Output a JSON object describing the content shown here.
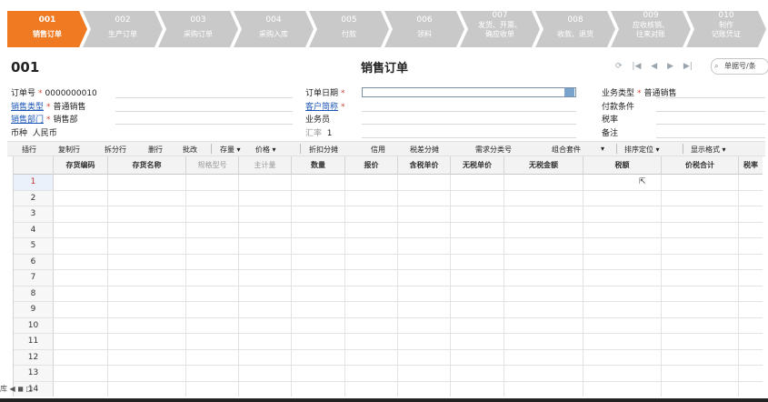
{
  "steps": [
    {
      "num": "001",
      "label": "销售订单",
      "active": true
    },
    {
      "num": "002",
      "label": "生产订单"
    },
    {
      "num": "003",
      "label": "采购订单"
    },
    {
      "num": "004",
      "label": "采购入库"
    },
    {
      "num": "005",
      "label": "付款"
    },
    {
      "num": "006",
      "label": "领料"
    },
    {
      "num": "007",
      "label": "发货、开票、\n确应收单",
      "multi": true
    },
    {
      "num": "008",
      "label": "收款、退货"
    },
    {
      "num": "009",
      "label": "应收核销、\n往来对账",
      "multi": true
    },
    {
      "num": "010",
      "label": "制作\n记账凭证",
      "multi": true
    }
  ],
  "colors": {
    "active_step": "#ef7a22",
    "inactive_step": "#c9c9c9",
    "link": "#1a55b5",
    "required": "#d24a3c"
  },
  "title": {
    "doc_no": "001",
    "doc_title": "销售订单"
  },
  "nav_icons": [
    "refresh-icon",
    "first-icon",
    "prev-icon",
    "next-icon",
    "last-icon"
  ],
  "search": {
    "placeholder": "单据号/条"
  },
  "header": {
    "order_no_label": "订单号",
    "order_no": "0000000010",
    "order_date_label": "订单日期",
    "biz_type_label": "业务类型",
    "biz_type": "普通销售",
    "sales_type_label": "销售类型",
    "sales_type": "普通销售",
    "customer_label": "客户简称",
    "payment_terms_label": "付款条件",
    "sales_dept_label": "销售部门",
    "sales_dept": "销售部",
    "salesperson_label": "业务员",
    "tax_rate_label": "税率",
    "currency_label": "币种",
    "currency": "人民币",
    "exchange_rate_label": "汇率",
    "exchange_rate": "1",
    "remark_label": "备注"
  },
  "toolbar": [
    "插行",
    "复制行",
    "拆分行",
    "删行",
    "批改",
    "存量 ▾",
    "价格 ▾",
    "折扣分摊",
    "信用",
    "税差分摊",
    "需求分类号",
    "组合套件",
    "▾",
    "排序定位 ▾",
    "显示格式 ▾"
  ],
  "columns": [
    "存货编码",
    "存货名称",
    "规格型号",
    "主计量",
    "数量",
    "报价",
    "含税单价",
    "无税单价",
    "无税金额",
    "税额",
    "价税合计",
    "税率"
  ],
  "rows": [
    "1",
    "2",
    "3",
    "4",
    "5",
    "6",
    "7",
    "8",
    "9",
    "10",
    "11",
    "12",
    "13",
    "14"
  ],
  "bottom_left_text": "库 ◀ ◼ □"
}
